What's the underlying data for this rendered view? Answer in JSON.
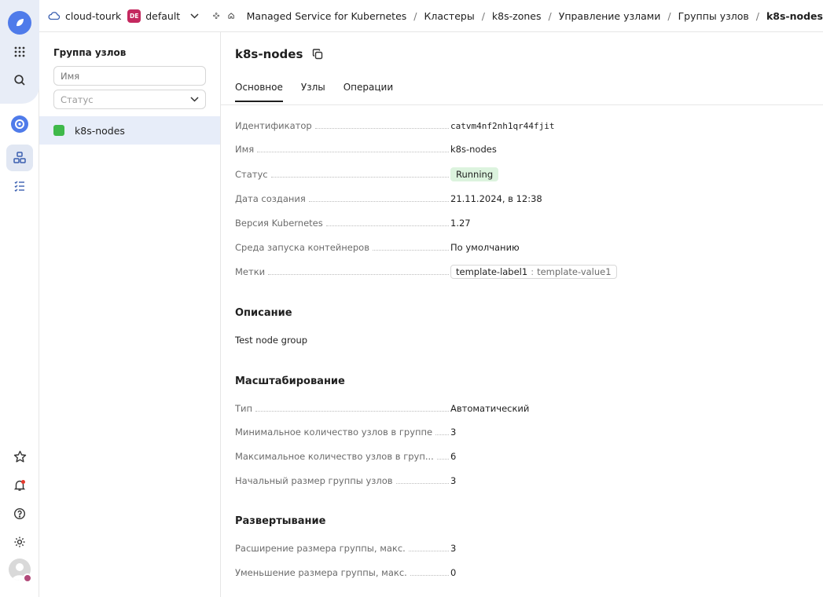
{
  "header": {
    "cloud_name": "cloud-tourk",
    "folder_badge": "DE",
    "folder_name": "default",
    "breadcrumbs": [
      "Managed Service for Kubernetes",
      "Кластеры",
      "k8s-zones",
      "Управление узлами",
      "Группы узлов",
      "k8s-nodes"
    ],
    "separator": "/"
  },
  "panel": {
    "title": "Группа узлов",
    "name_placeholder": "Имя",
    "status_placeholder": "Статус",
    "groups": [
      {
        "name": "k8s-nodes",
        "color": "#3fb94a"
      }
    ]
  },
  "main": {
    "title": "k8s-nodes",
    "tabs": [
      "Основное",
      "Узлы",
      "Операции"
    ],
    "active_tab": "Основное",
    "overview": {
      "id_label": "Идентификатор",
      "id_value": "catvm4nf2nh1qr44fjit",
      "name_label": "Имя",
      "name_value": "k8s-nodes",
      "status_label": "Статус",
      "status_value": "Running",
      "created_label": "Дата создания",
      "created_value": "21.11.2024, в 12:38",
      "k8s_version_label": "Версия Kubernetes",
      "k8s_version_value": "1.27",
      "runtime_label": "Среда запуска контейнеров",
      "runtime_value": "По умолчанию",
      "labels_label": "Метки",
      "label_key": "template-label1",
      "label_sep": ":",
      "label_value": "template-value1"
    },
    "description": {
      "title": "Описание",
      "text": "Test node group"
    },
    "scaling": {
      "title": "Масштабирование",
      "type_label": "Тип",
      "type_value": "Автоматический",
      "min_label": "Минимальное количество узлов в группе",
      "min_value": "3",
      "max_label": "Максимальное количество узлов в груп...",
      "max_value": "6",
      "initial_label": "Начальный размер группы узлов",
      "initial_value": "3"
    },
    "deployment": {
      "title": "Развертывание",
      "expand_label": "Расширение размера группы, макс.",
      "expand_value": "3",
      "shrink_label": "Уменьшение размера группы, макс.",
      "shrink_value": "0"
    }
  },
  "colors": {
    "accent": "#4f7bea",
    "status_bg": "#dcf3de",
    "status_fg": "#2d8a3a",
    "folder_badge": "#c4285f"
  }
}
